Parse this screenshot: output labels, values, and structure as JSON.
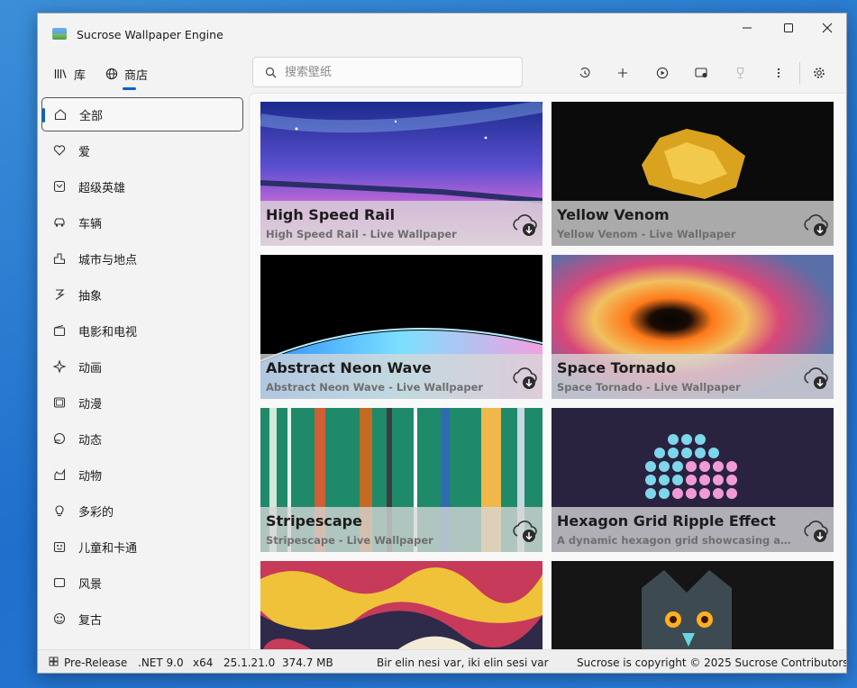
{
  "window": {
    "title": "Sucrose Wallpaper Engine"
  },
  "nav": {
    "library": "库",
    "store": "商店"
  },
  "search": {
    "placeholder": "搜索壁纸"
  },
  "toolbar": [
    "history-icon",
    "add-icon",
    "play-icon",
    "display-settings-icon",
    "trophy-icon",
    "more-icon",
    "settings-icon"
  ],
  "sidebar": {
    "items": [
      {
        "label": "全部",
        "icon": "home-icon"
      },
      {
        "label": "爱",
        "icon": "heart-icon"
      },
      {
        "label": "超级英雄",
        "icon": "superhero-icon"
      },
      {
        "label": "车辆",
        "icon": "vehicle-icon"
      },
      {
        "label": "城市与地点",
        "icon": "city-icon"
      },
      {
        "label": "抽象",
        "icon": "abstract-icon"
      },
      {
        "label": "电影和电视",
        "icon": "movie-icon"
      },
      {
        "label": "动画",
        "icon": "star-burst-icon"
      },
      {
        "label": "动漫",
        "icon": "frame-icon"
      },
      {
        "label": "动态",
        "icon": "motion-icon"
      },
      {
        "label": "动物",
        "icon": "animal-icon"
      },
      {
        "label": "多彩的",
        "icon": "bulb-icon"
      },
      {
        "label": "儿童和卡通",
        "icon": "kids-icon"
      },
      {
        "label": "风景",
        "icon": "landscape-icon"
      },
      {
        "label": "复古",
        "icon": "retro-icon"
      }
    ]
  },
  "cards": [
    {
      "title": "High Speed Rail",
      "subtitle": "High Speed Rail - Live Wallpaper"
    },
    {
      "title": "Yellow Venom",
      "subtitle": "Yellow Venom - Live Wallpaper"
    },
    {
      "title": "Abstract Neon Wave",
      "subtitle": "Abstract Neon Wave - Live Wallpaper"
    },
    {
      "title": "Space Tornado",
      "subtitle": "Space Tornado - Live Wallpaper"
    },
    {
      "title": "Stripescape",
      "subtitle": "Stripescape - Live Wallpaper"
    },
    {
      "title": "Hexagon Grid Ripple Effect",
      "subtitle": "A dynamic hexagon grid showcasing an e..."
    },
    {
      "title": "",
      "subtitle": ""
    },
    {
      "title": "",
      "subtitle": ""
    }
  ],
  "status": {
    "channel": "Pre-Release",
    "framework": ".NET 9.0",
    "arch": "x64",
    "version": "25.1.21.0",
    "memory": "374.7 MB",
    "quote": "Bir elin nesi var, iki elin sesi var",
    "copyright": "Sucrose is copyright © 2025 Sucrose Contributors"
  }
}
